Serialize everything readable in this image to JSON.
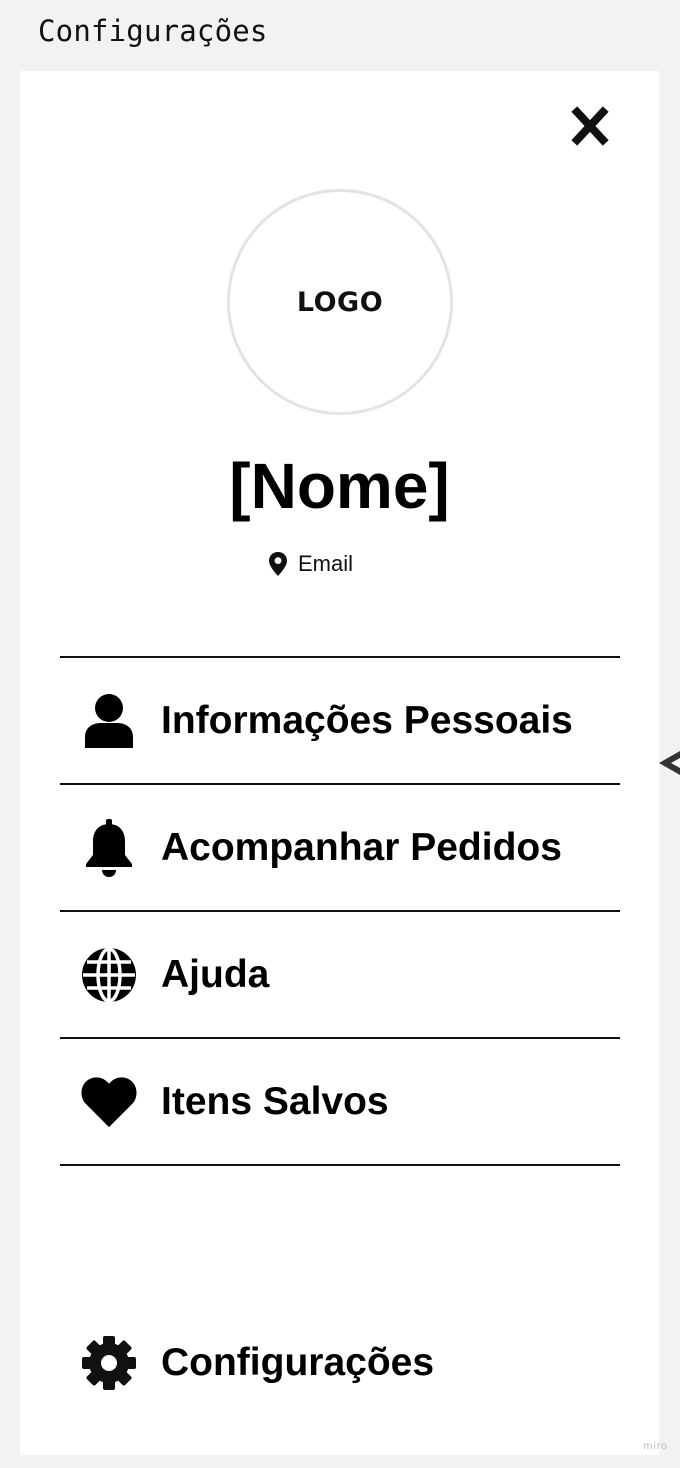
{
  "board": {
    "title": "Configurações",
    "watermark": "miro"
  },
  "profile": {
    "logo_text": "LOGO",
    "name": "[Nome]",
    "email_label": "Email",
    "email_icon": "location-pin-icon"
  },
  "menu": {
    "items": [
      {
        "label": "Informações Pessoais",
        "icon": "user-icon"
      },
      {
        "label": "Acompanhar Pedidos",
        "icon": "bell-icon"
      },
      {
        "label": "Ajuda",
        "icon": "globe-icon"
      },
      {
        "label": "Itens Salvos",
        "icon": "heart-icon"
      }
    ],
    "settings": {
      "label": "Configurações",
      "icon": "gear-icon"
    }
  },
  "icons": {
    "close": "close-icon",
    "edge_arrow": "arrow-left-icon"
  },
  "colors": {
    "board_background": "#f2f2f2",
    "frame_background": "#ffffff",
    "text": "#000000",
    "logo_border": "#e3e3e3"
  }
}
